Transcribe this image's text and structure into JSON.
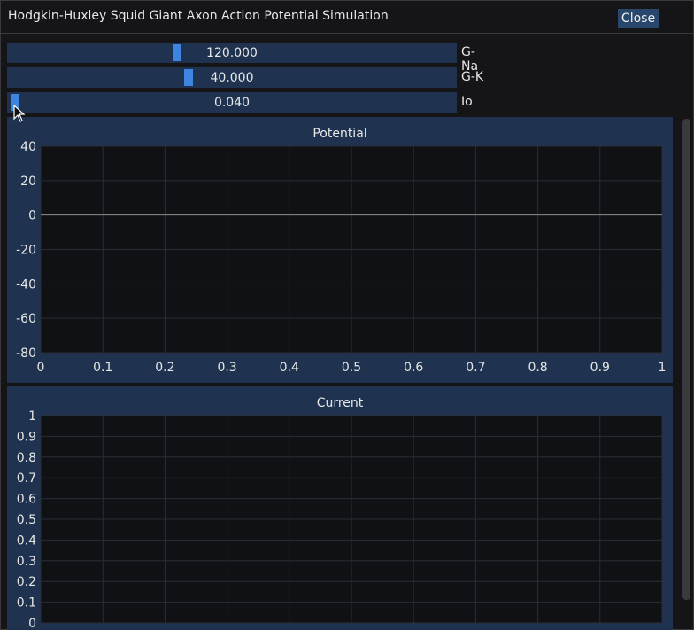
{
  "window": {
    "title": "Hodgkin-Huxley Squid Giant Axon Action Potential Simulation",
    "close_label": "Close"
  },
  "sliders": [
    {
      "label": "G-Na",
      "display": "120.000",
      "value": 120,
      "min": 0,
      "max": 320
    },
    {
      "label": "G-K",
      "display": "40.000",
      "value": 40,
      "min": 0,
      "max": 100
    },
    {
      "label": "Io",
      "display": "0.040",
      "value": 0.04,
      "min": 0,
      "max": 10
    }
  ],
  "colors": {
    "panel_bg": "#1f3350",
    "plot_bg": "#0f1115",
    "grid": "#2a2d33",
    "accent": "#3d85e0"
  },
  "chart_data": [
    {
      "type": "line",
      "title": "Potential",
      "xlim": [
        0,
        1
      ],
      "ylim": [
        -80,
        40
      ],
      "xticks": [
        "0",
        "0.1",
        "0.2",
        "0.3",
        "0.4",
        "0.5",
        "0.6",
        "0.7",
        "0.8",
        "0.9",
        "1"
      ],
      "yticks": [
        "40",
        "20",
        "0",
        "-20",
        "-40",
        "-60",
        "-80"
      ],
      "series": [
        {
          "x": [
            0,
            1
          ],
          "y": [
            0,
            0
          ],
          "color": "#8a8a8a"
        }
      ],
      "grid": true
    },
    {
      "type": "line",
      "title": "Current",
      "xlim": [
        0,
        1
      ],
      "ylim": [
        0,
        1
      ],
      "yticks": [
        "1",
        "0.9",
        "0.8",
        "0.7",
        "0.6",
        "0.5",
        "0.4",
        "0.3",
        "0.2",
        "0.1",
        "0"
      ],
      "series": [],
      "grid": true
    }
  ]
}
